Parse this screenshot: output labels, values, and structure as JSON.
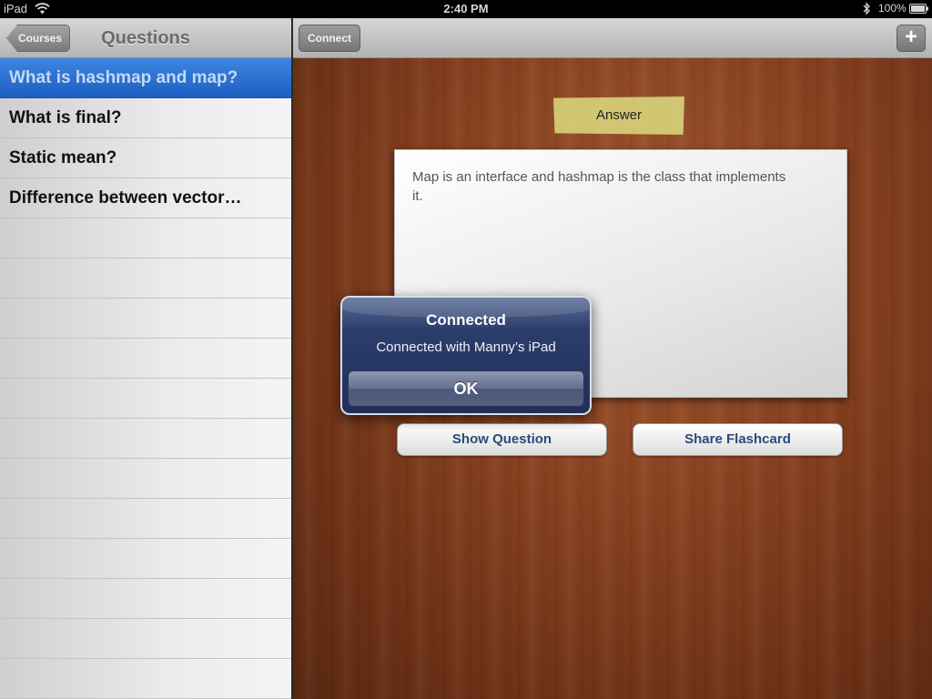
{
  "status_bar": {
    "carrier": "iPad",
    "time": "2:40 PM",
    "battery": "100%"
  },
  "master": {
    "back_label": "Courses",
    "title": "Questions",
    "questions": [
      "What is hashmap and map?",
      "What is final?",
      "Static mean?",
      "Difference between vector…"
    ],
    "selected_index": 0
  },
  "detail": {
    "connect_label": "Connect",
    "add_label": "+",
    "answer_tag": "Answer",
    "answer_text": "Map is an interface and hashmap is the class that implements it.",
    "show_question_label": "Show Question",
    "share_flashcard_label": "Share Flashcard"
  },
  "alert": {
    "title": "Connected",
    "message": "Connected with Manny’s iPad",
    "ok_label": "OK"
  },
  "colors": {
    "selection_blue": "#2a6fd2",
    "wood": "#86401f",
    "alert_navy": "#1f2f5a"
  },
  "icons": {
    "wifi": "wifi-icon",
    "bluetooth": "bluetooth-icon",
    "battery": "battery-icon"
  }
}
